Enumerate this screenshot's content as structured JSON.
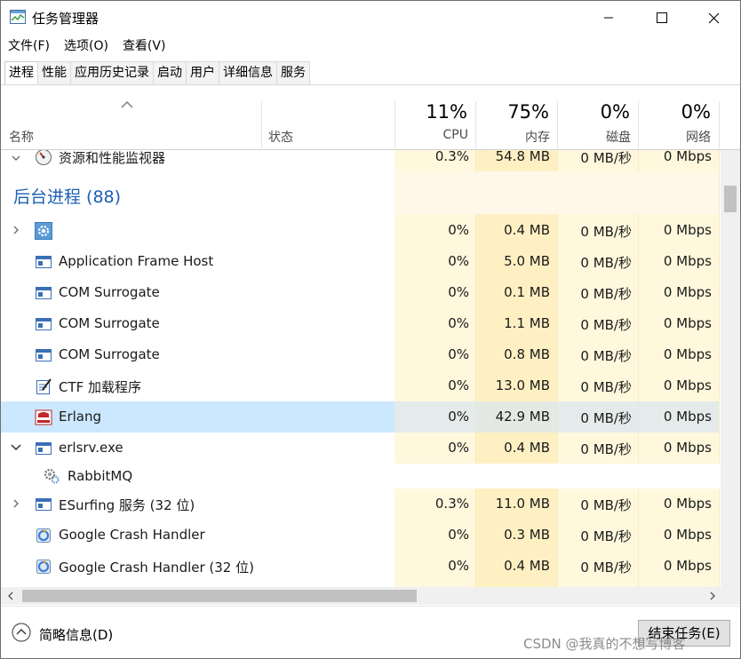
{
  "window": {
    "title": "任务管理器",
    "controls": {
      "minimize_icon": "minimize-icon",
      "maximize_icon": "maximize-icon",
      "close_icon": "close-icon"
    }
  },
  "menu": [
    {
      "label": "文件(F)"
    },
    {
      "label": "选项(O)"
    },
    {
      "label": "查看(V)"
    }
  ],
  "tabs": [
    {
      "label": "进程",
      "active": true
    },
    {
      "label": "性能"
    },
    {
      "label": "应用历史记录"
    },
    {
      "label": "启动"
    },
    {
      "label": "用户"
    },
    {
      "label": "详细信息"
    },
    {
      "label": "服务"
    }
  ],
  "columns": {
    "name": "名称",
    "status": "状态",
    "cpu": {
      "pct": "11%",
      "label": "CPU"
    },
    "mem": {
      "pct": "75%",
      "label": "内存"
    },
    "disk": {
      "pct": "0%",
      "label": "磁盘"
    },
    "net": {
      "pct": "0%",
      "label": "网络"
    }
  },
  "top_row": {
    "name": "资源和性能监视器",
    "cpu": "0.3%",
    "mem": "54.8 MB",
    "disk": "0 MB/秒",
    "net": "0 Mbps",
    "icon": "resource-monitor-icon"
  },
  "group": {
    "title": "后台进程 (88)"
  },
  "rows": [
    {
      "name": "",
      "cpu": "0%",
      "mem": "0.4 MB",
      "disk": "0 MB/秒",
      "net": "0 Mbps",
      "icon": "gear-icon",
      "expand": "collapsed"
    },
    {
      "name": "Application Frame Host",
      "cpu": "0%",
      "mem": "5.0 MB",
      "disk": "0 MB/秒",
      "net": "0 Mbps",
      "icon": "app-window-icon"
    },
    {
      "name": "COM Surrogate",
      "cpu": "0%",
      "mem": "0.1 MB",
      "disk": "0 MB/秒",
      "net": "0 Mbps",
      "icon": "app-window-icon"
    },
    {
      "name": "COM Surrogate",
      "cpu": "0%",
      "mem": "1.1 MB",
      "disk": "0 MB/秒",
      "net": "0 Mbps",
      "icon": "app-window-icon"
    },
    {
      "name": "COM Surrogate",
      "cpu": "0%",
      "mem": "0.8 MB",
      "disk": "0 MB/秒",
      "net": "0 Mbps",
      "icon": "app-window-icon"
    },
    {
      "name": "CTF 加载程序",
      "cpu": "0%",
      "mem": "13.0 MB",
      "disk": "0 MB/秒",
      "net": "0 Mbps",
      "icon": "pen-notepad-icon"
    },
    {
      "name": "Erlang",
      "cpu": "0%",
      "mem": "42.9 MB",
      "disk": "0 MB/秒",
      "net": "0 Mbps",
      "icon": "erlang-icon",
      "selected": true
    },
    {
      "name": "erlsrv.exe",
      "cpu": "0%",
      "mem": "0.4 MB",
      "disk": "0 MB/秒",
      "net": "0 Mbps",
      "icon": "app-window-icon",
      "expand": "expanded"
    },
    {
      "name": "RabbitMQ",
      "child": true,
      "icon": "service-gears-icon"
    },
    {
      "name": "ESurfing 服务 (32 位)",
      "cpu": "0.3%",
      "mem": "11.0 MB",
      "disk": "0 MB/秒",
      "net": "0 Mbps",
      "icon": "app-window-icon",
      "expand": "collapsed"
    },
    {
      "name": "Google Crash Handler",
      "cpu": "0%",
      "mem": "0.3 MB",
      "disk": "0 MB/秒",
      "net": "0 Mbps",
      "icon": "google-update-icon"
    },
    {
      "name": "Google Crash Handler (32 位)",
      "cpu": "0%",
      "mem": "0.4 MB",
      "disk": "0 MB/秒",
      "net": "0 Mbps",
      "icon": "google-update-icon"
    }
  ],
  "footer": {
    "brief_label": "简略信息(D)",
    "end_task_label": "结束任务(E)",
    "watermark": "CSDN @我真的不想写博客"
  },
  "colors": {
    "accent_blue": "#1c5fb4",
    "selected_row": "#cce8ff",
    "cpu_bg": "#fff8dd",
    "mem_bg": "#fff0c3"
  }
}
